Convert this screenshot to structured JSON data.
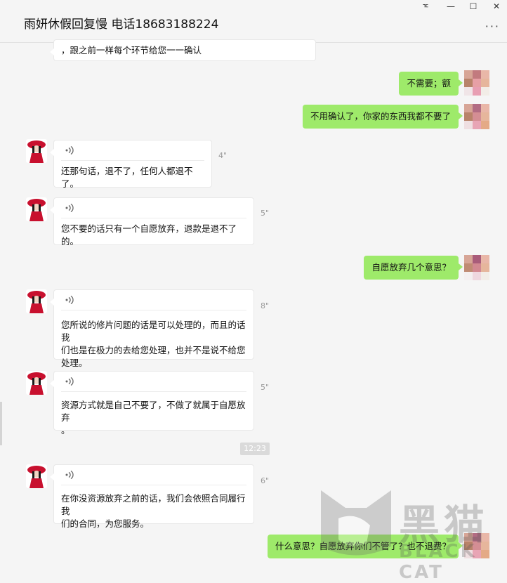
{
  "window": {
    "title": "雨妍休假回复慢 电话18683188224",
    "pin_glyph": "ᅚ",
    "minimize_glyph": "—",
    "maximize_glyph": "☐",
    "close_glyph": "✕",
    "more_glyph": "···"
  },
  "messages": [
    {
      "side": "left",
      "voice": false,
      "text": "，跟之前一样每个环节给您一一确认"
    },
    {
      "side": "right",
      "text": "不需要；额"
    },
    {
      "side": "right",
      "text": "不用确认了，你家的东西我都不要了"
    },
    {
      "side": "left",
      "voice": true,
      "duration": "4\"",
      "text": "还那句话，退不了，任何人都退不了。"
    },
    {
      "side": "left",
      "voice": true,
      "duration": "5\"",
      "text": "您不要的话只有一个自愿放弃，退款是退不了的。"
    },
    {
      "side": "right",
      "text": "自愿放弃几个意思？"
    },
    {
      "side": "left",
      "voice": true,
      "duration": "8\"",
      "text_lines": [
        "您所说的修片问题的话是可以处理的，而且的话我",
        "们也是在极力的去给您处理，也并不是说不给您处理。"
      ]
    },
    {
      "side": "left",
      "voice": true,
      "duration": "5\"",
      "text_lines": [
        "资源方式就是自己不要了，不做了就属于自愿放弃",
        "。"
      ]
    },
    {
      "side": "left",
      "voice": true,
      "duration": "6\"",
      "text_lines": [
        "在你没资源放弃之前的话，我们会依照合同履行我",
        "们的合同，为您服务。"
      ]
    },
    {
      "side": "right",
      "text": "什么意思？自愿放弃你们不管了？也不退费？"
    }
  ],
  "time_divider": "12:23",
  "watermark": {
    "chinese": "黑猫",
    "english": "BLACK CAT"
  },
  "colors": {
    "self_bubble": "#9eea6a",
    "other_bubble": "#ffffff",
    "background": "#f5f5f5"
  },
  "icons": {
    "voice": "voice-wave-icon",
    "avatar_other": "red-hat-woman-avatar",
    "avatar_self": "pixelated-avatar"
  }
}
